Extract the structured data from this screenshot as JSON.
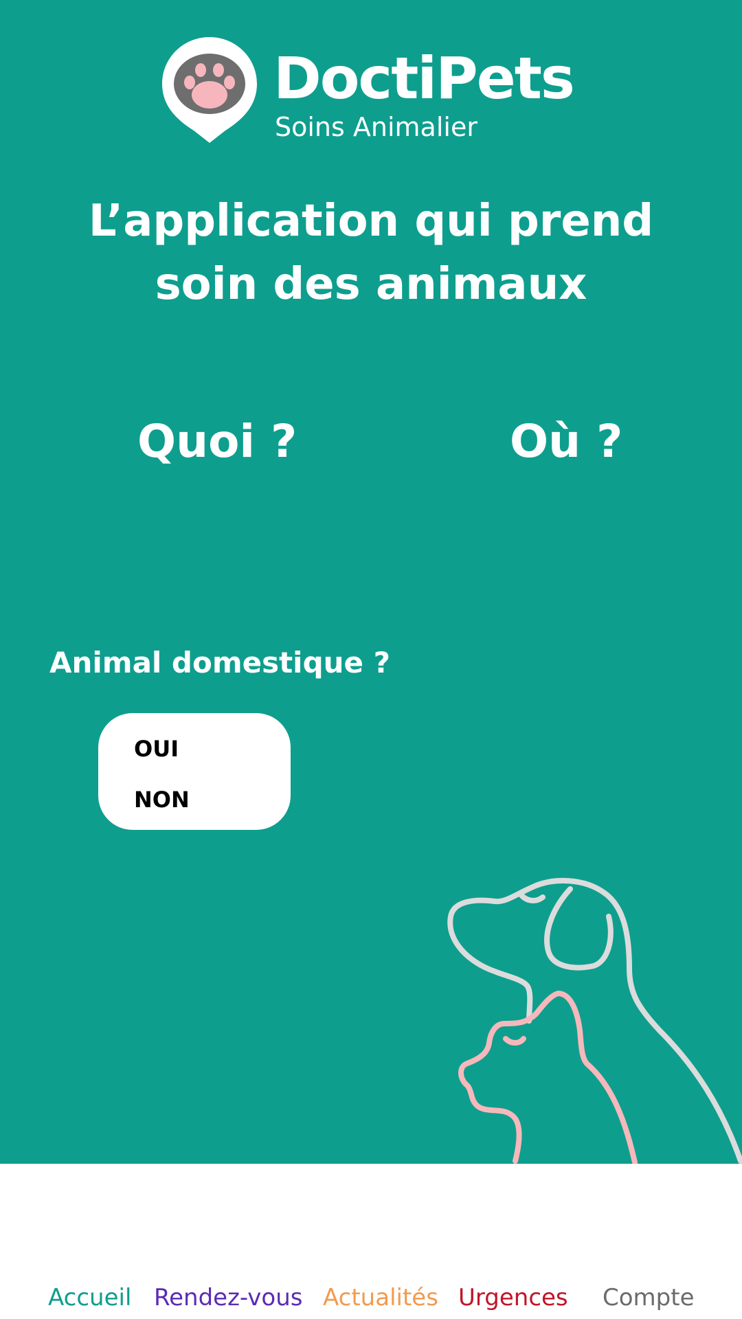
{
  "brand": {
    "name": "DoctiPets",
    "tagline": "Soins Animalier",
    "logo_icon": "paw-pin-icon"
  },
  "headline": {
    "line1": "L’application qui prend",
    "line2": "soin des animaux"
  },
  "search": {
    "what_label": "Quoi ?",
    "where_label": "Où ?"
  },
  "domestic": {
    "question": "Animal domestique ?",
    "options": [
      "OUI",
      "NON"
    ]
  },
  "nav": {
    "items": [
      {
        "label": "Accueil",
        "color": "#0e9e8e"
      },
      {
        "label": "Rendez-vous",
        "color": "#5b2bb5"
      },
      {
        "label": "Actualités",
        "color": "#f39a4e"
      },
      {
        "label": "Urgences",
        "color": "#c0152a"
      },
      {
        "label": "Compte",
        "color": "#6b6b6b"
      }
    ]
  },
  "colors": {
    "primary": "#0e9e8e",
    "dog_outline": "#dcdcdc",
    "cat_outline": "#f6b8bb",
    "paw_pad": "#f7b6bd",
    "paw_base": "#6e6e6e"
  }
}
